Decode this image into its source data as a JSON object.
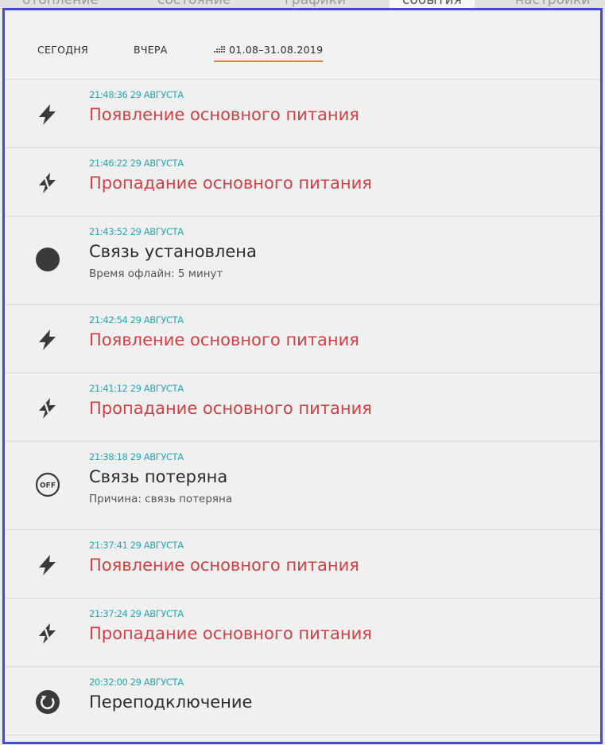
{
  "tabs": [
    {
      "label": "отопление",
      "active": false
    },
    {
      "label": "состояние",
      "active": false
    },
    {
      "label": "графики",
      "active": false
    },
    {
      "label": "события",
      "active": true
    },
    {
      "label": "настройки",
      "active": false
    }
  ],
  "filters": {
    "today": "СЕГОДНЯ",
    "yesterday": "ВЧЕРА",
    "range": "01.08–31.08.2019"
  },
  "events": [
    {
      "time": "21:48:36 29 АВГУСТА",
      "title": "Появление основного питания",
      "detail": "",
      "icon": "lightning-icon",
      "color": "#d04146"
    },
    {
      "time": "21:46:22 29 АВГУСТА",
      "title": "Пропадание основного питания",
      "detail": "",
      "icon": "lightning-off-icon",
      "color": "#d04146"
    },
    {
      "time": "21:43:52 29 АВГУСТА",
      "title": "Связь установлена",
      "detail": "Время офлайн: 5 минут",
      "icon": "online-dot-icon",
      "color": "#2b2b2b"
    },
    {
      "time": "21:42:54 29 АВГУСТА",
      "title": "Появление основного питания",
      "detail": "",
      "icon": "lightning-icon",
      "color": "#d04146"
    },
    {
      "time": "21:41:12 29 АВГУСТА",
      "title": "Пропадание основного питания",
      "detail": "",
      "icon": "lightning-off-icon",
      "color": "#d04146"
    },
    {
      "time": "21:38:18 29 АВГУСТА",
      "title": "Связь потеряна",
      "detail": "Причина: связь потеряна",
      "icon": "off-badge-icon",
      "color": "#2b2b2b"
    },
    {
      "time": "21:37:41 29 АВГУСТА",
      "title": "Появление основного питания",
      "detail": "",
      "icon": "lightning-icon",
      "color": "#d04146"
    },
    {
      "time": "21:37:24 29 АВГУСТА",
      "title": "Пропадание основного питания",
      "detail": "",
      "icon": "lightning-off-icon",
      "color": "#d04146"
    },
    {
      "time": "20:32:00 29 АВГУСТА",
      "title": "Переподключение",
      "detail": "",
      "icon": "reconnect-icon",
      "color": "#2b2b2b"
    }
  ],
  "off_label": "OFF",
  "colors": {
    "frame": "#4348d8",
    "accent": "#e8783a",
    "time": "#27a7b3",
    "alert": "#d04146"
  }
}
